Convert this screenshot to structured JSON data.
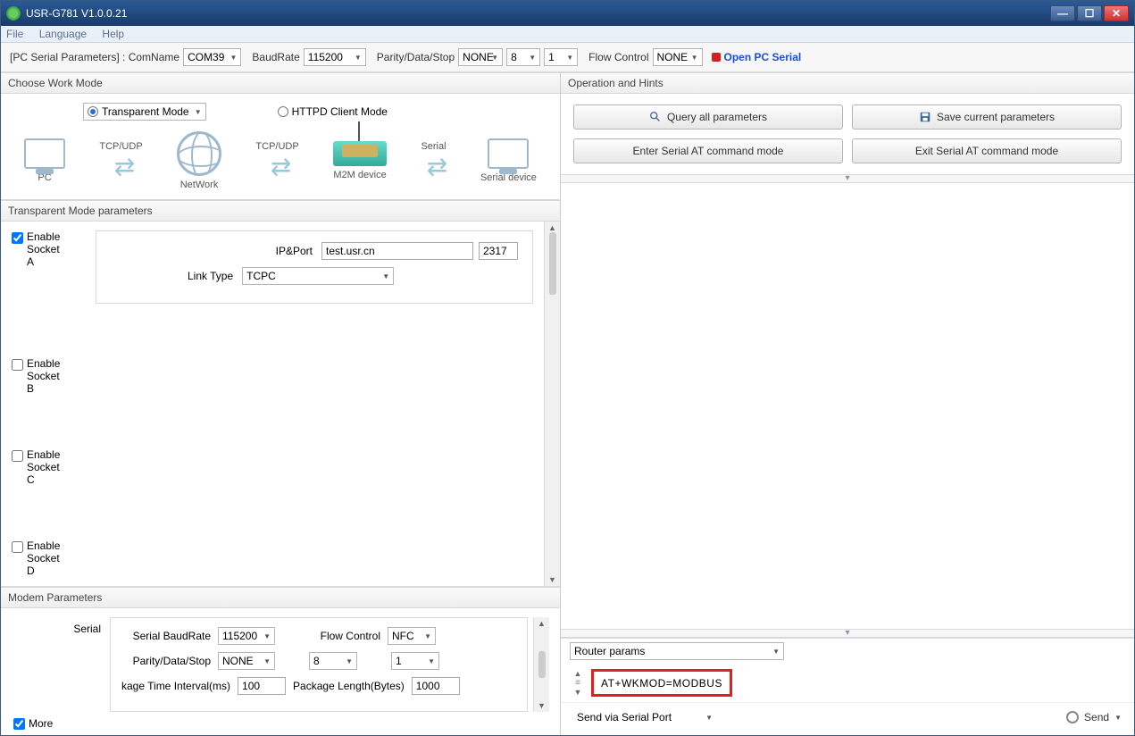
{
  "window": {
    "title": "USR-G781 V1.0.0.21"
  },
  "menu": {
    "file": "File",
    "language": "Language",
    "help": "Help"
  },
  "toolbar": {
    "pcserial_label": "[PC Serial Parameters] : ComName",
    "comname": "COM39",
    "baud_label": "BaudRate",
    "baud": "115200",
    "pds_label": "Parity/Data/Stop",
    "parity": "NONE",
    "data": "8",
    "stop": "1",
    "flow_label": "Flow Control",
    "flow": "NONE",
    "open_label": "Open PC Serial"
  },
  "workmode": {
    "header": "Choose Work Mode",
    "transparent": "Transparent Mode",
    "httpd": "HTTPD Client Mode",
    "tcpudp": "TCP/UDP",
    "serial": "Serial",
    "pc": "PC",
    "network": "NetWork",
    "m2m": "M2M device",
    "serialdev": "Serial device"
  },
  "trans": {
    "header": "Transparent Mode parameters",
    "enable": "Enable",
    "socketA": "Socket A",
    "socketB": "Socket B",
    "socketC": "Socket C",
    "socketD": "Socket D",
    "ipport_label": "IP&Port",
    "ip": "test.usr.cn",
    "port": "2317",
    "linktype_label": "Link Type",
    "linktype": "TCPC"
  },
  "modem": {
    "header": "Modem Parameters",
    "serial_label": "Serial",
    "baud_label": "Serial BaudRate",
    "baud": "115200",
    "flow_label": "Flow Control",
    "flow": "NFC",
    "pds_label": "Parity/Data/Stop",
    "parity": "NONE",
    "data": "8",
    "stop": "1",
    "pkgtime_label": "kage Time Interval(ms)",
    "pkgtime": "100",
    "pkglen_label": "Package Length(Bytes)",
    "pkglen": "1000",
    "more": "More"
  },
  "ops": {
    "header": "Operation and Hints",
    "query": "Query all parameters",
    "save": "Save current parameters",
    "enter_at": "Enter Serial AT command mode",
    "exit_at": "Exit Serial AT command mode"
  },
  "router": {
    "params_label": "Router params"
  },
  "cmd": {
    "text": "AT+WKMOD=MODBUS"
  },
  "send": {
    "via": "Send via Serial Port",
    "btn": "Send"
  }
}
